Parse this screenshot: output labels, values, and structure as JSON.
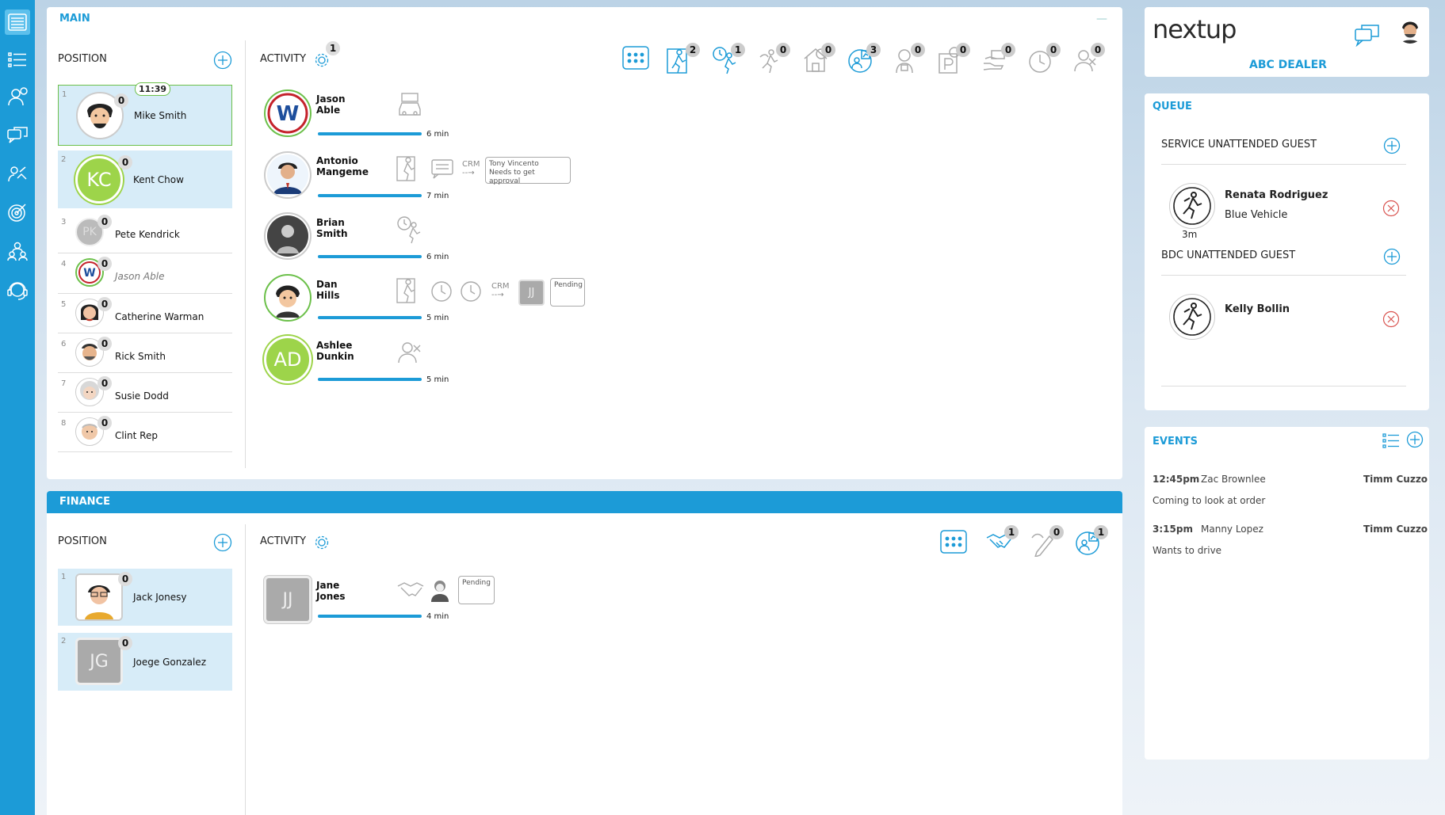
{
  "brand": {
    "logo_text": "nextup",
    "dealer": "ABC DEALER"
  },
  "colors": {
    "accent": "#1c9bd7",
    "selected_border": "#6cc04a",
    "highlight_row": "#d7ecf8"
  },
  "sidebar": {
    "items": [
      {
        "icon": "floor-list-icon",
        "active": true
      },
      {
        "icon": "checklist-icon"
      },
      {
        "icon": "user-question-icon"
      },
      {
        "icon": "chat-icon"
      },
      {
        "icon": "user-handshake-icon"
      },
      {
        "icon": "target-icon"
      },
      {
        "icon": "team-icon"
      },
      {
        "icon": "headset-icon"
      }
    ]
  },
  "main": {
    "title": "MAIN",
    "position_header": "POSITION",
    "activity_header": "ACTIVITY",
    "activity_count": "1",
    "positions": [
      {
        "num": "1",
        "name": "Mike Smith",
        "badge": "0",
        "timer": "11:39"
      },
      {
        "num": "2",
        "name": "Kent Chow",
        "badge": "0",
        "initials": "KC"
      },
      {
        "num": "3",
        "name": "Pete Kendrick",
        "badge": "0",
        "initials": "PK"
      },
      {
        "num": "4",
        "name": "Jason Able",
        "badge": "0"
      },
      {
        "num": "5",
        "name": "Catherine Warman",
        "badge": "0"
      },
      {
        "num": "6",
        "name": "Rick Smith",
        "badge": "0"
      },
      {
        "num": "7",
        "name": "Susie Dodd",
        "badge": "0"
      },
      {
        "num": "8",
        "name": "Clint Rep",
        "badge": "0"
      }
    ],
    "activity_icons": [
      {
        "icon": "grid-icon",
        "count": ""
      },
      {
        "icon": "walk-in-icon",
        "count": "2"
      },
      {
        "icon": "appointment-walk-icon",
        "count": "1"
      },
      {
        "icon": "be-back-icon",
        "count": "0"
      },
      {
        "icon": "home-delivery-icon",
        "count": "0"
      },
      {
        "icon": "people-chart-icon",
        "count": "3"
      },
      {
        "icon": "lock-user-icon",
        "count": "0"
      },
      {
        "icon": "parking-icon",
        "count": "0"
      },
      {
        "icon": "hand-money-icon",
        "count": "0"
      },
      {
        "icon": "clock-icon",
        "count": "0"
      },
      {
        "icon": "user-cancel-icon",
        "count": "0"
      }
    ],
    "activities": [
      {
        "first": "Jason",
        "last": "Able",
        "mins": "6 min",
        "progress": 1.0
      },
      {
        "first": "Antonio",
        "last": "Mangeme",
        "mins": "7 min",
        "progress": 1.0,
        "crm": "CRM",
        "note_line1": "Tony Vincento",
        "note_line2": "Needs to get approval"
      },
      {
        "first": "Brian",
        "last": "Smith",
        "mins": "6 min",
        "progress": 1.0
      },
      {
        "first": "Dan",
        "last": "Hills",
        "mins": "5 min",
        "progress": 1.0,
        "crm": "CRM",
        "assignee": "JJ",
        "status": "Pending"
      },
      {
        "first": "Ashlee",
        "last": "Dunkin",
        "mins": "5 min",
        "progress": 1.0,
        "initials": "AD"
      }
    ]
  },
  "finance": {
    "title": "FINANCE",
    "position_header": "POSITION",
    "activity_header": "ACTIVITY",
    "positions": [
      {
        "num": "1",
        "name": "Jack Jonesy",
        "badge": "0"
      },
      {
        "num": "2",
        "name": "Joege Gonzalez",
        "badge": "0",
        "initials": "JG"
      }
    ],
    "activity_icons": [
      {
        "icon": "grid-icon",
        "count": ""
      },
      {
        "icon": "handshake-icon",
        "count": "1"
      },
      {
        "icon": "pen-sign-icon",
        "count": "0"
      },
      {
        "icon": "people-chart-icon",
        "count": "1"
      }
    ],
    "activities": [
      {
        "first": "Jane",
        "last": "Jones",
        "mins": "4 min",
        "progress": 1.0,
        "initials": "JJ",
        "status": "Pending"
      }
    ]
  },
  "queue": {
    "title": "QUEUE",
    "service_header": "SERVICE UNATTENDED GUEST",
    "service_guest": {
      "name": "Renata Rodriguez",
      "detail": "Blue Vehicle",
      "wait": "3m"
    },
    "bdc_header": "BDC UNATTENDED GUEST",
    "bdc_guest": {
      "name": "Kelly Bollin"
    }
  },
  "events": {
    "title": "EVENTS",
    "items": [
      {
        "time": "12:45pm",
        "who": "Zac Brownlee",
        "owner": "Timm Cuzzo",
        "note": "Coming to look at order"
      },
      {
        "time": "3:15pm",
        "who": "Manny Lopez",
        "owner": "Timm Cuzzo",
        "note": "Wants to drive"
      }
    ]
  }
}
